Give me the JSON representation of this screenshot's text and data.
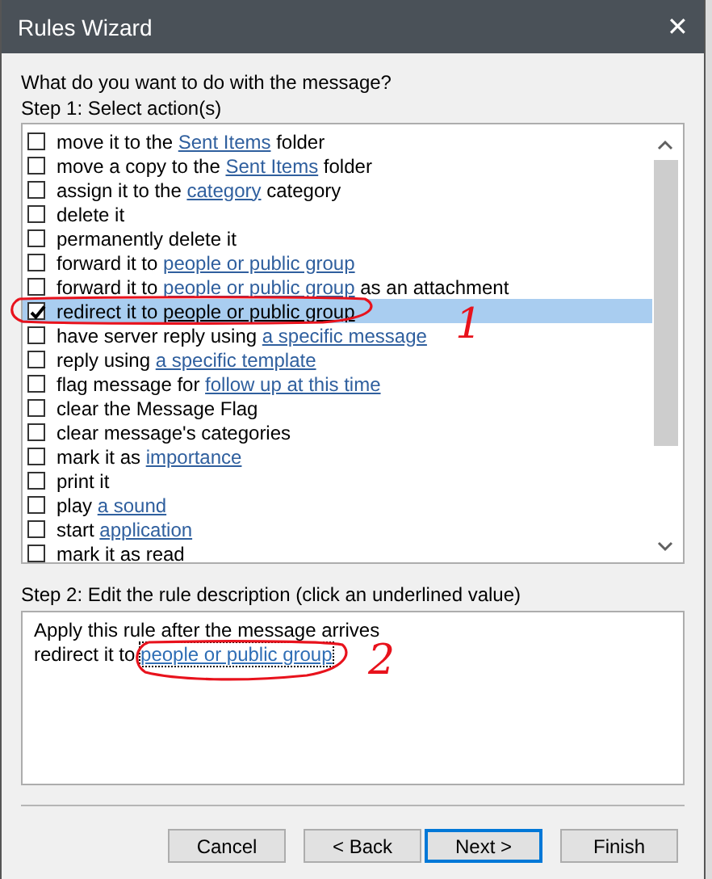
{
  "window": {
    "title": "Rules Wizard",
    "close": "✕"
  },
  "question": "What do you want to do with the message?",
  "step1_label": "Step 1: Select action(s)",
  "actions": [
    {
      "checked": false,
      "selected": false,
      "parts": [
        {
          "kind": "text",
          "text": "move it to the "
        },
        {
          "kind": "link",
          "text": "Sent Items"
        },
        {
          "kind": "text",
          "text": " folder"
        }
      ]
    },
    {
      "checked": false,
      "selected": false,
      "parts": [
        {
          "kind": "text",
          "text": "move a copy to the "
        },
        {
          "kind": "link",
          "text": "Sent Items"
        },
        {
          "kind": "text",
          "text": " folder"
        }
      ]
    },
    {
      "checked": false,
      "selected": false,
      "parts": [
        {
          "kind": "text",
          "text": "assign it to the "
        },
        {
          "kind": "link",
          "text": "category"
        },
        {
          "kind": "text",
          "text": " category"
        }
      ]
    },
    {
      "checked": false,
      "selected": false,
      "parts": [
        {
          "kind": "text",
          "text": "delete it"
        }
      ]
    },
    {
      "checked": false,
      "selected": false,
      "parts": [
        {
          "kind": "text",
          "text": "permanently delete it"
        }
      ]
    },
    {
      "checked": false,
      "selected": false,
      "parts": [
        {
          "kind": "text",
          "text": "forward it to "
        },
        {
          "kind": "link",
          "text": "people or public group"
        }
      ]
    },
    {
      "checked": false,
      "selected": false,
      "parts": [
        {
          "kind": "text",
          "text": "forward it to "
        },
        {
          "kind": "link",
          "text": "people or public group"
        },
        {
          "kind": "text",
          "text": " as an attachment"
        }
      ]
    },
    {
      "checked": true,
      "selected": true,
      "parts": [
        {
          "kind": "text",
          "text": "redirect it to "
        },
        {
          "kind": "link",
          "text": "people or public group"
        }
      ]
    },
    {
      "checked": false,
      "selected": false,
      "parts": [
        {
          "kind": "text",
          "text": "have server reply using "
        },
        {
          "kind": "link",
          "text": "a specific message"
        }
      ]
    },
    {
      "checked": false,
      "selected": false,
      "parts": [
        {
          "kind": "text",
          "text": "reply using "
        },
        {
          "kind": "link",
          "text": "a specific template"
        }
      ]
    },
    {
      "checked": false,
      "selected": false,
      "parts": [
        {
          "kind": "text",
          "text": "flag message for "
        },
        {
          "kind": "link",
          "text": "follow up at this time"
        }
      ]
    },
    {
      "checked": false,
      "selected": false,
      "parts": [
        {
          "kind": "text",
          "text": "clear the Message Flag"
        }
      ]
    },
    {
      "checked": false,
      "selected": false,
      "parts": [
        {
          "kind": "text",
          "text": "clear message's categories"
        }
      ]
    },
    {
      "checked": false,
      "selected": false,
      "parts": [
        {
          "kind": "text",
          "text": "mark it as "
        },
        {
          "kind": "link",
          "text": "importance"
        }
      ]
    },
    {
      "checked": false,
      "selected": false,
      "parts": [
        {
          "kind": "text",
          "text": "print it"
        }
      ]
    },
    {
      "checked": false,
      "selected": false,
      "parts": [
        {
          "kind": "text",
          "text": "play "
        },
        {
          "kind": "link",
          "text": "a sound"
        }
      ]
    },
    {
      "checked": false,
      "selected": false,
      "parts": [
        {
          "kind": "text",
          "text": "start "
        },
        {
          "kind": "link",
          "text": "application"
        }
      ]
    },
    {
      "checked": false,
      "selected": false,
      "parts": [
        {
          "kind": "text",
          "text": "mark it as read"
        }
      ]
    }
  ],
  "step2_label": "Step 2: Edit the rule description (click an underlined value)",
  "description": [
    {
      "parts": [
        {
          "kind": "text",
          "text": "Apply this rule after the message arrives"
        }
      ]
    },
    {
      "parts": [
        {
          "kind": "text",
          "text": "redirect it to "
        },
        {
          "kind": "link",
          "text": "people or public group",
          "focused": true
        }
      ]
    }
  ],
  "buttons": [
    {
      "label": "Cancel",
      "default": false
    },
    {
      "label": "< Back",
      "default": false
    },
    {
      "label": "Next >",
      "default": true
    },
    {
      "label": "Finish",
      "default": false
    }
  ],
  "annotations": [
    {
      "label": "1"
    },
    {
      "label": "2"
    }
  ]
}
